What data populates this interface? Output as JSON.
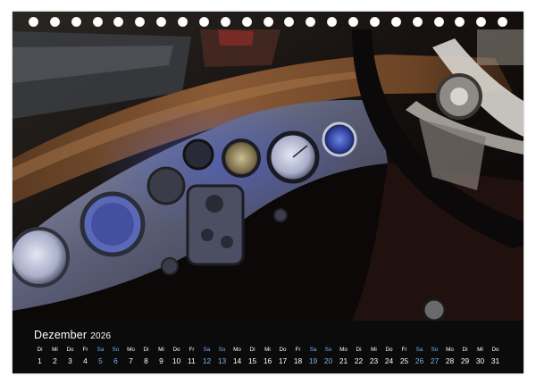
{
  "calendar": {
    "month": "Dezember",
    "year": "2026",
    "weekend_color": "#7fb2e8",
    "days": [
      {
        "wd": "Di",
        "d": "1",
        "weekend": false
      },
      {
        "wd": "Mi",
        "d": "2",
        "weekend": false
      },
      {
        "wd": "Do",
        "d": "3",
        "weekend": false
      },
      {
        "wd": "Fr",
        "d": "4",
        "weekend": false
      },
      {
        "wd": "Sa",
        "d": "5",
        "weekend": true
      },
      {
        "wd": "So",
        "d": "6",
        "weekend": true
      },
      {
        "wd": "Mo",
        "d": "7",
        "weekend": false
      },
      {
        "wd": "Di",
        "d": "8",
        "weekend": false
      },
      {
        "wd": "Mi",
        "d": "9",
        "weekend": false
      },
      {
        "wd": "Do",
        "d": "10",
        "weekend": false
      },
      {
        "wd": "Fr",
        "d": "11",
        "weekend": false
      },
      {
        "wd": "Sa",
        "d": "12",
        "weekend": true
      },
      {
        "wd": "So",
        "d": "13",
        "weekend": true
      },
      {
        "wd": "Mo",
        "d": "14",
        "weekend": false
      },
      {
        "wd": "Di",
        "d": "15",
        "weekend": false
      },
      {
        "wd": "Mi",
        "d": "16",
        "weekend": false
      },
      {
        "wd": "Do",
        "d": "17",
        "weekend": false
      },
      {
        "wd": "Fr",
        "d": "18",
        "weekend": false
      },
      {
        "wd": "Sa",
        "d": "19",
        "weekend": true
      },
      {
        "wd": "So",
        "d": "20",
        "weekend": true
      },
      {
        "wd": "Mo",
        "d": "21",
        "weekend": false
      },
      {
        "wd": "Di",
        "d": "22",
        "weekend": false
      },
      {
        "wd": "Mi",
        "d": "23",
        "weekend": false
      },
      {
        "wd": "Do",
        "d": "24",
        "weekend": false
      },
      {
        "wd": "Fr",
        "d": "25",
        "weekend": false
      },
      {
        "wd": "Sa",
        "d": "26",
        "weekend": true
      },
      {
        "wd": "So",
        "d": "27",
        "weekend": true
      },
      {
        "wd": "Mo",
        "d": "28",
        "weekend": false
      },
      {
        "wd": "Di",
        "d": "29",
        "weekend": false
      },
      {
        "wd": "Mi",
        "d": "30",
        "weekend": false
      },
      {
        "wd": "Do",
        "d": "31",
        "weekend": false
      }
    ]
  }
}
